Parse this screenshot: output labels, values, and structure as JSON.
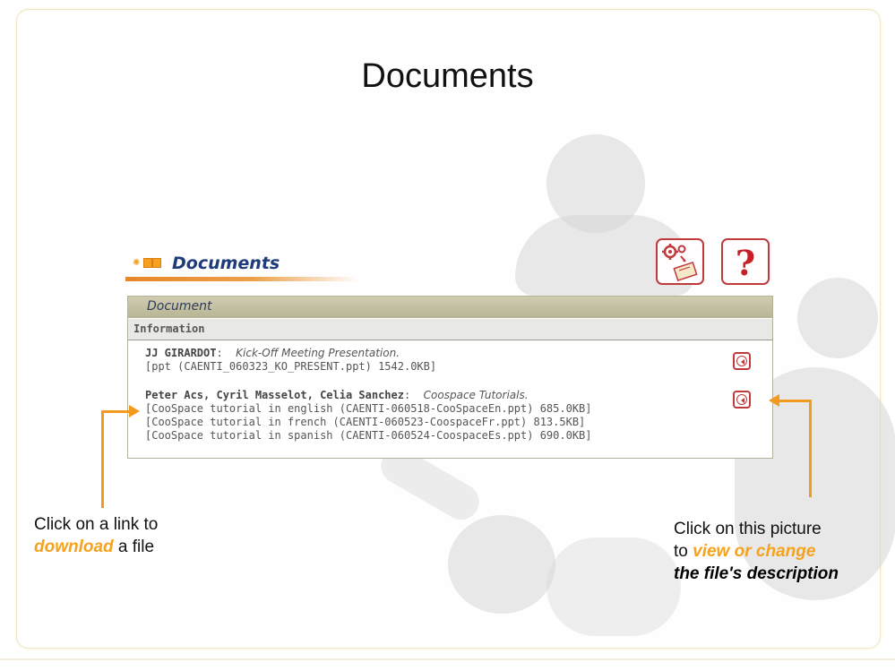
{
  "slide": {
    "title": "Documents"
  },
  "panel": {
    "heading": "Documents",
    "icons": {
      "config": "settings-gears-icon",
      "help": "help-question-icon",
      "help_glyph": "?"
    },
    "table": {
      "header": "Document",
      "subheader": "Information",
      "entries": [
        {
          "author": "JJ GIRARDOT",
          "separator": ":",
          "description": "Kick-Off Meeting Presentation.",
          "files": [
            "[ppt (CAENTI_060323_KO_PRESENT.ppt) 1542.0KB]"
          ]
        },
        {
          "author": "Peter Acs, Cyril Masselot, Celia Sanchez",
          "separator": ":",
          "description": "Coospace Tutorials.",
          "files": [
            "[CooSpace tutorial in english (CAENTI-060518-CooSpaceEn.ppt) 685.0KB]",
            "[CooSpace tutorial in french (CAENTI-060523-CoospaceFr.ppt) 813.5KB]",
            "[CooSpace tutorial in spanish (CAENTI-060524-CoospaceEs.ppt) 690.0KB]"
          ]
        }
      ],
      "view_button_icon": "view-description-icon"
    }
  },
  "callouts": {
    "left": {
      "line1": "Click on a link to",
      "highlight": "download",
      "rest": " a file"
    },
    "right": {
      "line1": "Click on this picture",
      "prefix": "to ",
      "highlight": "view or change",
      "line3": "the file's description"
    }
  },
  "colors": {
    "accent_orange": "#f29a1e",
    "heading_blue": "#1f3b7a",
    "button_red": "#c0393b"
  }
}
